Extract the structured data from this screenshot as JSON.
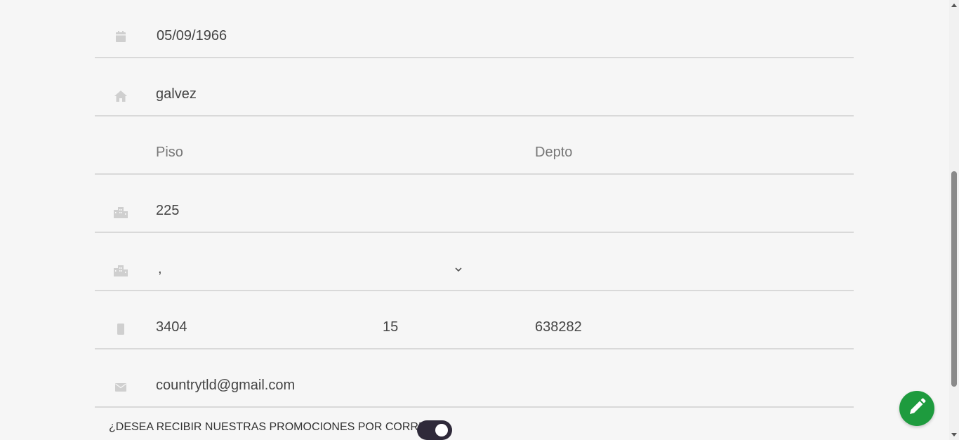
{
  "form": {
    "birthdate": {
      "value": "05/09/1966",
      "icon": "calendar-icon"
    },
    "street": {
      "value": "galvez",
      "icon": "home-icon"
    },
    "floor": {
      "placeholder": "Piso"
    },
    "apartment": {
      "placeholder": "Depto"
    },
    "number": {
      "value": "225",
      "icon": "building-icon"
    },
    "city_select": {
      "value": ",",
      "icon": "building-icon"
    },
    "phone": {
      "area_code": "3404",
      "prefix": "15",
      "number": "638282",
      "icon": "mobile-icon"
    },
    "email": {
      "value": "countrytld@gmail.com",
      "icon": "envelope-icon"
    }
  },
  "promotions": {
    "question": "¿DESEA RECIBIR NUESTRAS PROMOCIONES POR CORREO?",
    "enabled": true
  },
  "fab": {
    "icon": "pencil-icon",
    "color": "#1e9b3e"
  },
  "colors": {
    "background": "#f6f6f6",
    "divider": "#d9d9d9",
    "icon": "#cfcfcf",
    "toggle": "#2f2a3a"
  }
}
